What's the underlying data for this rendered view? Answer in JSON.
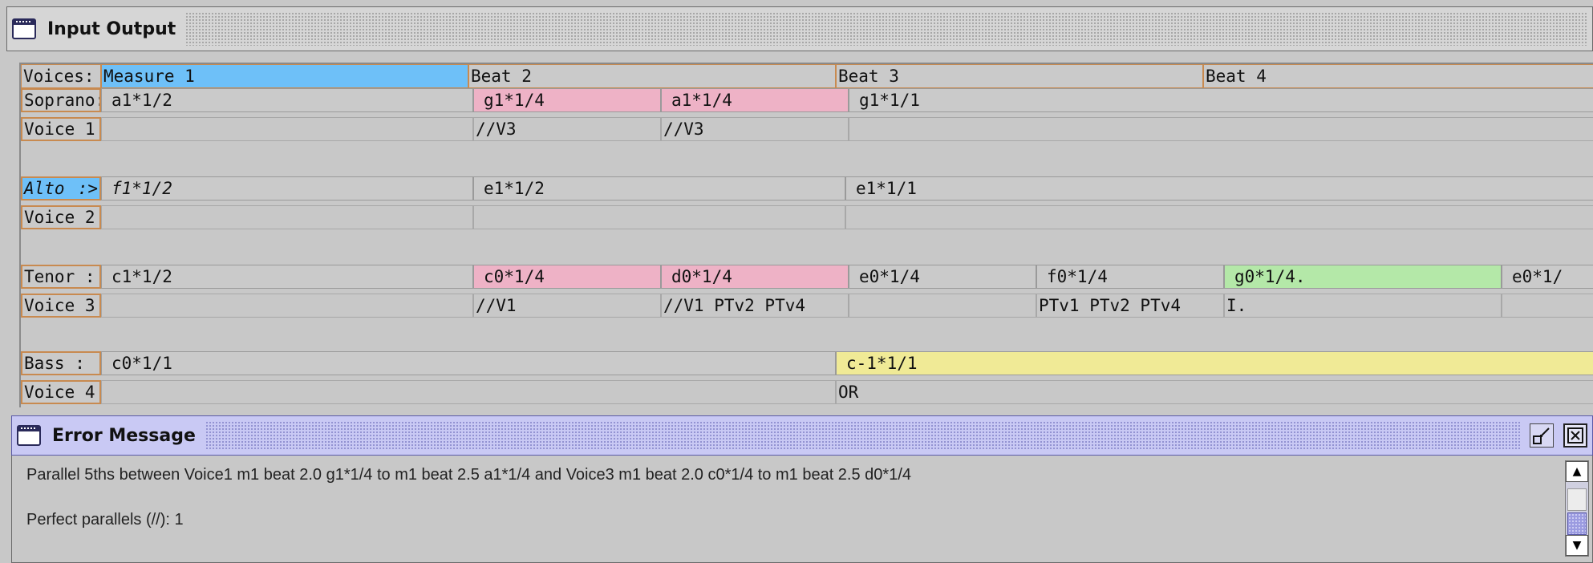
{
  "io_window": {
    "title": "Input Output",
    "icon": "window-icon"
  },
  "measure_header": {
    "label": "Voices:",
    "measure": "Measure 1",
    "beats": [
      "Beat 2",
      "Beat 3",
      "Beat 4"
    ]
  },
  "voices": {
    "soprano": {
      "label": "Soprano:",
      "sub_label": "Voice 1",
      "notes": [
        "a1*1/2",
        "g1*1/4",
        "a1*1/4",
        "g1*1/1"
      ],
      "annotations": [
        "//V3",
        "//V3"
      ]
    },
    "alto": {
      "label": "Alto",
      "marker": ":>",
      "sub_label": "Voice 2",
      "notes": [
        "f1*1/2",
        "e1*1/2",
        "e1*1/1"
      ]
    },
    "tenor": {
      "label": "Tenor  :",
      "sub_label": "Voice 3",
      "notes": [
        "c1*1/2",
        "c0*1/4",
        "d0*1/4",
        "e0*1/4",
        "f0*1/4",
        "g0*1/4.",
        "e0*1/"
      ],
      "annotations": [
        "//V1",
        "//V1 PTv2 PTv4",
        "PTv1 PTv2 PTv4",
        "I."
      ]
    },
    "bass": {
      "label": "Bass   :",
      "sub_label": "Voice 4",
      "notes": [
        "c0*1/1",
        "c-1*1/1"
      ],
      "annotations": [
        "OR"
      ]
    }
  },
  "highlight_colors": {
    "selected": "#6ec0f8",
    "parallel_error": "#eeb2c6",
    "passing": "#b4e8a8",
    "range_warning": "#f0ea96"
  },
  "error_window": {
    "title": "Error Message",
    "icon": "window-icon",
    "restore_icon": "restore-icon",
    "close_icon": "close-icon",
    "lines": [
      "Parallel 5ths between Voice1 m1 beat 2.0 g1*1/4 to m1 beat 2.5 a1*1/4 and Voice3 m1 beat 2.0 c0*1/4 to m1 beat 2.5 d0*1/4",
      "Perfect parallels (//): 1"
    ]
  }
}
